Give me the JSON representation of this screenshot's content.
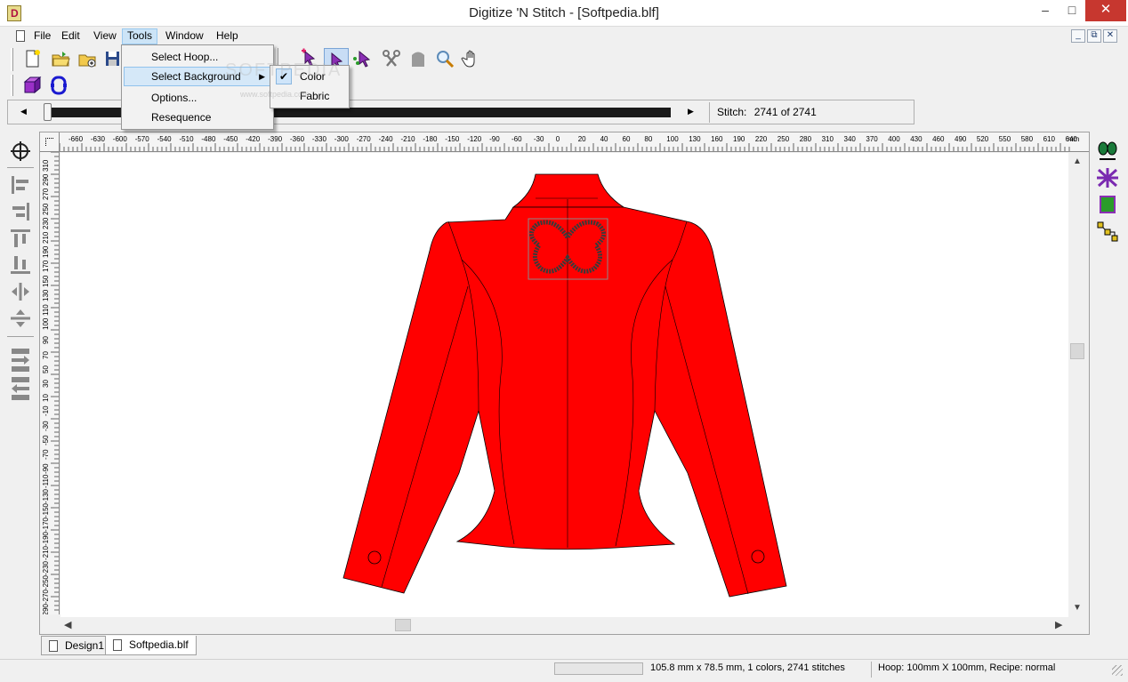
{
  "window": {
    "title": "Digitize 'N Stitch - [Softpedia.blf]",
    "minimize_glyph": "–",
    "maximize_glyph": "□",
    "close_glyph": "✕"
  },
  "menubar": {
    "items": [
      "File",
      "Edit",
      "View",
      "Tools",
      "Window",
      "Help"
    ],
    "active": "Tools"
  },
  "tools_menu": {
    "items": [
      {
        "label": "Select Hoop..."
      },
      {
        "label": "Select Background",
        "has_submenu": true
      },
      {
        "label": "Options..."
      },
      {
        "label": "Resequence"
      }
    ],
    "background_submenu": {
      "items": [
        {
          "label": "Color",
          "checked": true
        },
        {
          "label": "Fabric",
          "checked": false
        }
      ]
    }
  },
  "watermark": {
    "text": "SOFTPEDIA",
    "url": "www.softpedia.com"
  },
  "player": {
    "stitch_label": "Stitch:",
    "stitch_value": "2741 of 2741",
    "position_fraction": 1.0
  },
  "rulers": {
    "unit": "mm",
    "top_labels": [
      "-660",
      "-630",
      "-600",
      "-570",
      "-540",
      "-510",
      "-480",
      "-450",
      "-420",
      "-390",
      "-360",
      "-330",
      "-300",
      "-270",
      "-240",
      "-210",
      "-180",
      "-150",
      "-120",
      "-90",
      "-60",
      "-30",
      "0",
      "20",
      "40",
      "60",
      "80",
      "100",
      "130",
      "160",
      "190",
      "220",
      "250",
      "280",
      "310",
      "340",
      "370",
      "400",
      "430",
      "460",
      "490",
      "520",
      "550",
      "580",
      "610",
      "640"
    ],
    "left_labels": [
      "310",
      "290",
      "270",
      "250",
      "230",
      "210",
      "190",
      "170",
      "150",
      "130",
      "110",
      "100",
      "90",
      "70",
      "50",
      "30",
      "10",
      "-10",
      "-30",
      "-50",
      "-70",
      "-90",
      "-110",
      "-130",
      "-150",
      "-170",
      "-190",
      "-210",
      "-230",
      "-250",
      "-270",
      "-290"
    ]
  },
  "tabs": [
    {
      "label": "Design1",
      "active": false
    },
    {
      "label": "Softpedia.blf",
      "active": true
    }
  ],
  "status": {
    "design_info": "105.8 mm x 78.5 mm, 1 colors, 2741 stitches",
    "hoop_info": "Hoop: 100mm X 100mm, Recipe: normal"
  },
  "colors": {
    "jacket": "#ff0000",
    "stitch": "#3a3a3a",
    "menu_highlight": "#d5e8f8",
    "close_button": "#c7372f"
  },
  "icons": {
    "toolbar": [
      "new-file-icon",
      "open-folder-icon",
      "open-add-icon",
      "save-icon",
      "select-arrow-icon",
      "node-edit-icon",
      "split-icon",
      "shape-icon",
      "zoom-icon",
      "pan-hand-icon",
      "cube-icon",
      "outline-shape-icon"
    ],
    "left_panel": [
      "crosshair-icon",
      "align-left-icon",
      "align-right-icon",
      "align-top-icon",
      "align-bottom-icon",
      "center-horizontal-icon",
      "center-vertical-icon",
      "move-forward-icon",
      "move-backward-icon"
    ],
    "right_panel": [
      "footprint-icon",
      "fill-pattern-icon",
      "chip-icon",
      "path-nodes-icon"
    ]
  }
}
